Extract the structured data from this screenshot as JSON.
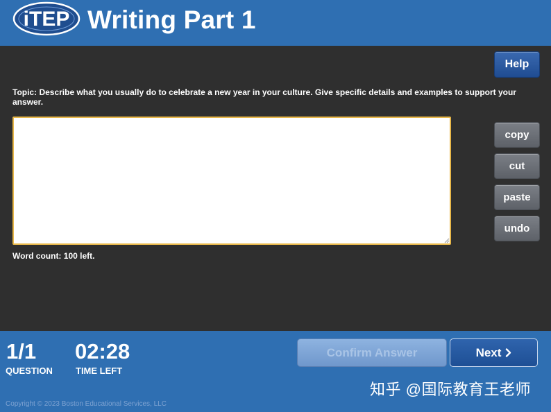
{
  "header": {
    "logo_text": "iTEP",
    "title": "Writing Part 1"
  },
  "toolbar": {
    "help_label": "Help",
    "copy_label": "copy",
    "cut_label": "cut",
    "paste_label": "paste",
    "undo_label": "undo"
  },
  "task": {
    "topic": "Topic: Describe what you usually do to celebrate a new year in your culture. Give specific details and examples to support your answer.",
    "answer_value": "",
    "word_count": "Word count: 100 left."
  },
  "footer": {
    "question_number": "1/1",
    "question_label": "QUESTION",
    "time_left_value": "02:28",
    "time_left_label": "TIME LEFT",
    "confirm_label": "Confirm Answer",
    "next_label": "Next",
    "copyright": "Copyright © 2023 Boston Educational Services, LLC",
    "watermark": "知乎 @国际教育王老师"
  },
  "colors": {
    "header_blue": "#2f6fb2",
    "panel_dark": "#2f2f2f",
    "textarea_border": "#e8b84a"
  }
}
